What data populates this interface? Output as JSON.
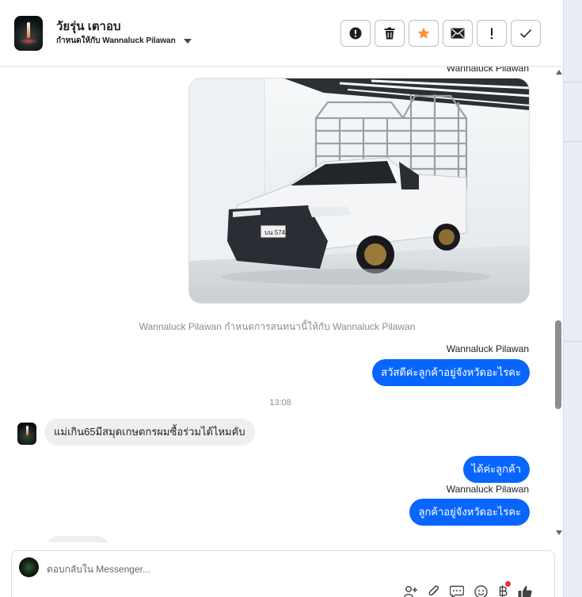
{
  "header": {
    "contact_name": "วัยรุ่น เตาอบ",
    "assigned_to": "กำหนดให้กับ Wannaluck Pilawan",
    "actions": [
      {
        "name": "spam-button",
        "icon": "alert-circle-icon"
      },
      {
        "name": "delete-button",
        "icon": "trash-icon"
      },
      {
        "name": "star-button",
        "icon": "star-icon",
        "color": "#f7923b"
      },
      {
        "name": "mark-unread-button",
        "icon": "envelope-icon"
      },
      {
        "name": "follow-up-button",
        "icon": "exclamation-icon"
      },
      {
        "name": "mark-done-button",
        "icon": "check-icon"
      }
    ]
  },
  "conversation": {
    "sender_label_1": "Wannaluck Pilawan",
    "photo_alt": "รูปรถกระบะสีขาวติดคอกเหล็ก",
    "system_message": "Wannaluck Pilawan กำหนดการสนทนานี้ให้กับ Wannaluck Pilawan",
    "sender_label_2": "Wannaluck Pilawan",
    "message_out_1": "สวัสดีค่ะลูกค้าอยู่จังหวัดอะไรคะ",
    "timestamp": "13:08",
    "message_in_1": "แม่เกิน65มีสมุดเกษตกรผมซื้อร่วมได้ไหมคับ",
    "message_out_2": "ได้ค่ะลูกค้า",
    "sender_label_3": "Wannaluck Pilawan",
    "message_out_3": "ลูกค้าอยู่จังหวัดอะไรคะ"
  },
  "composer": {
    "placeholder": "ตอบกลับใน Messenger...",
    "icons": [
      "add-contact-icon",
      "paperclip-icon",
      "saved-reply-icon",
      "emoji-icon",
      "baht-payment-icon",
      "thumbs-up-icon"
    ]
  },
  "colors": {
    "accent": "#0866ff",
    "star": "#f7923b",
    "incoming_bubble": "#eeeff1",
    "notification_dot": "#f0284a"
  }
}
